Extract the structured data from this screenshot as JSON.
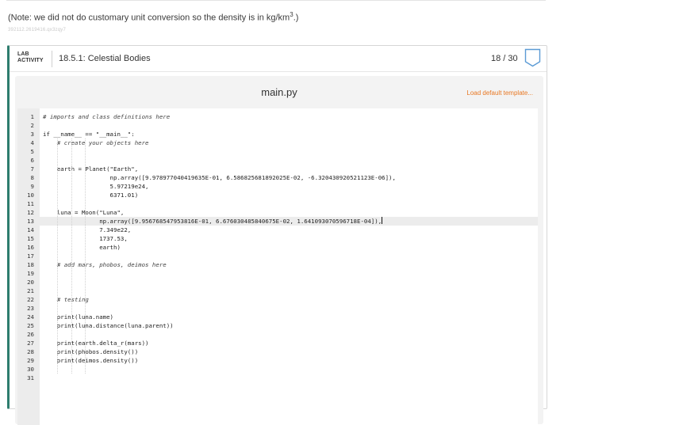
{
  "note": {
    "text": "(Note: we did not do customary unit conversion so the density is in kg/km",
    "superscript": "3",
    "suffix": ".)"
  },
  "watermark": "392112.2619416.qx3zqy7",
  "lab": {
    "tag_line1": "LAB",
    "tag_line2": "ACTIVITY",
    "title": "18.5.1: Celestial Bodies",
    "score": "18 / 30",
    "badge_icon": "score-badge-icon",
    "accent_color": "#2e7d6e"
  },
  "editor": {
    "filename": "main.py",
    "load_template_label": "Load default template...",
    "load_template_color": "#e87722",
    "active_line": 13,
    "lines": [
      {
        "n": "1",
        "text": "# imports and class definitions here",
        "kind": "comment"
      },
      {
        "n": "2",
        "text": "",
        "kind": "code"
      },
      {
        "n": "3",
        "text": "if __name__ == \"__main__\":",
        "kind": "code"
      },
      {
        "n": "4",
        "text": "    # create your objects here",
        "kind": "comment"
      },
      {
        "n": "5",
        "text": "",
        "kind": "code"
      },
      {
        "n": "6",
        "text": "",
        "kind": "code"
      },
      {
        "n": "7",
        "text": "    earth = Planet(\"Earth\",",
        "kind": "code"
      },
      {
        "n": "8",
        "text": "                   np.array([9.978977040419635E-01, 6.586825681892025E-02, -6.320430920521123E-06]),",
        "kind": "code"
      },
      {
        "n": "9",
        "text": "                   5.97219e24,",
        "kind": "code"
      },
      {
        "n": "10",
        "text": "                   6371.01)",
        "kind": "code"
      },
      {
        "n": "11",
        "text": "",
        "kind": "code"
      },
      {
        "n": "12",
        "text": "    luna = Moon(\"Luna\",",
        "kind": "code"
      },
      {
        "n": "13",
        "text": "                np.array([9.956768547953816E-01, 6.676030485840675E-02, 1.641093070596718E-04]),",
        "kind": "code"
      },
      {
        "n": "14",
        "text": "                7.349e22,",
        "kind": "code"
      },
      {
        "n": "15",
        "text": "                1737.53,",
        "kind": "code"
      },
      {
        "n": "16",
        "text": "                earth)",
        "kind": "code"
      },
      {
        "n": "17",
        "text": "",
        "kind": "code"
      },
      {
        "n": "18",
        "text": "    # add mars, phobos, deimos here",
        "kind": "comment"
      },
      {
        "n": "19",
        "text": "",
        "kind": "code"
      },
      {
        "n": "20",
        "text": "",
        "kind": "code"
      },
      {
        "n": "21",
        "text": "",
        "kind": "code"
      },
      {
        "n": "22",
        "text": "    # testing",
        "kind": "comment"
      },
      {
        "n": "23",
        "text": "",
        "kind": "code"
      },
      {
        "n": "24",
        "text": "    print(luna.name)",
        "kind": "code"
      },
      {
        "n": "25",
        "text": "    print(luna.distance(luna.parent))",
        "kind": "code"
      },
      {
        "n": "26",
        "text": "",
        "kind": "code"
      },
      {
        "n": "27",
        "text": "    print(earth.delta_r(mars))",
        "kind": "code"
      },
      {
        "n": "28",
        "text": "    print(phobos.density())",
        "kind": "code"
      },
      {
        "n": "29",
        "text": "    print(deimos.density())",
        "kind": "code"
      },
      {
        "n": "30",
        "text": "",
        "kind": "code"
      },
      {
        "n": "31",
        "text": "",
        "kind": "code"
      }
    ]
  }
}
